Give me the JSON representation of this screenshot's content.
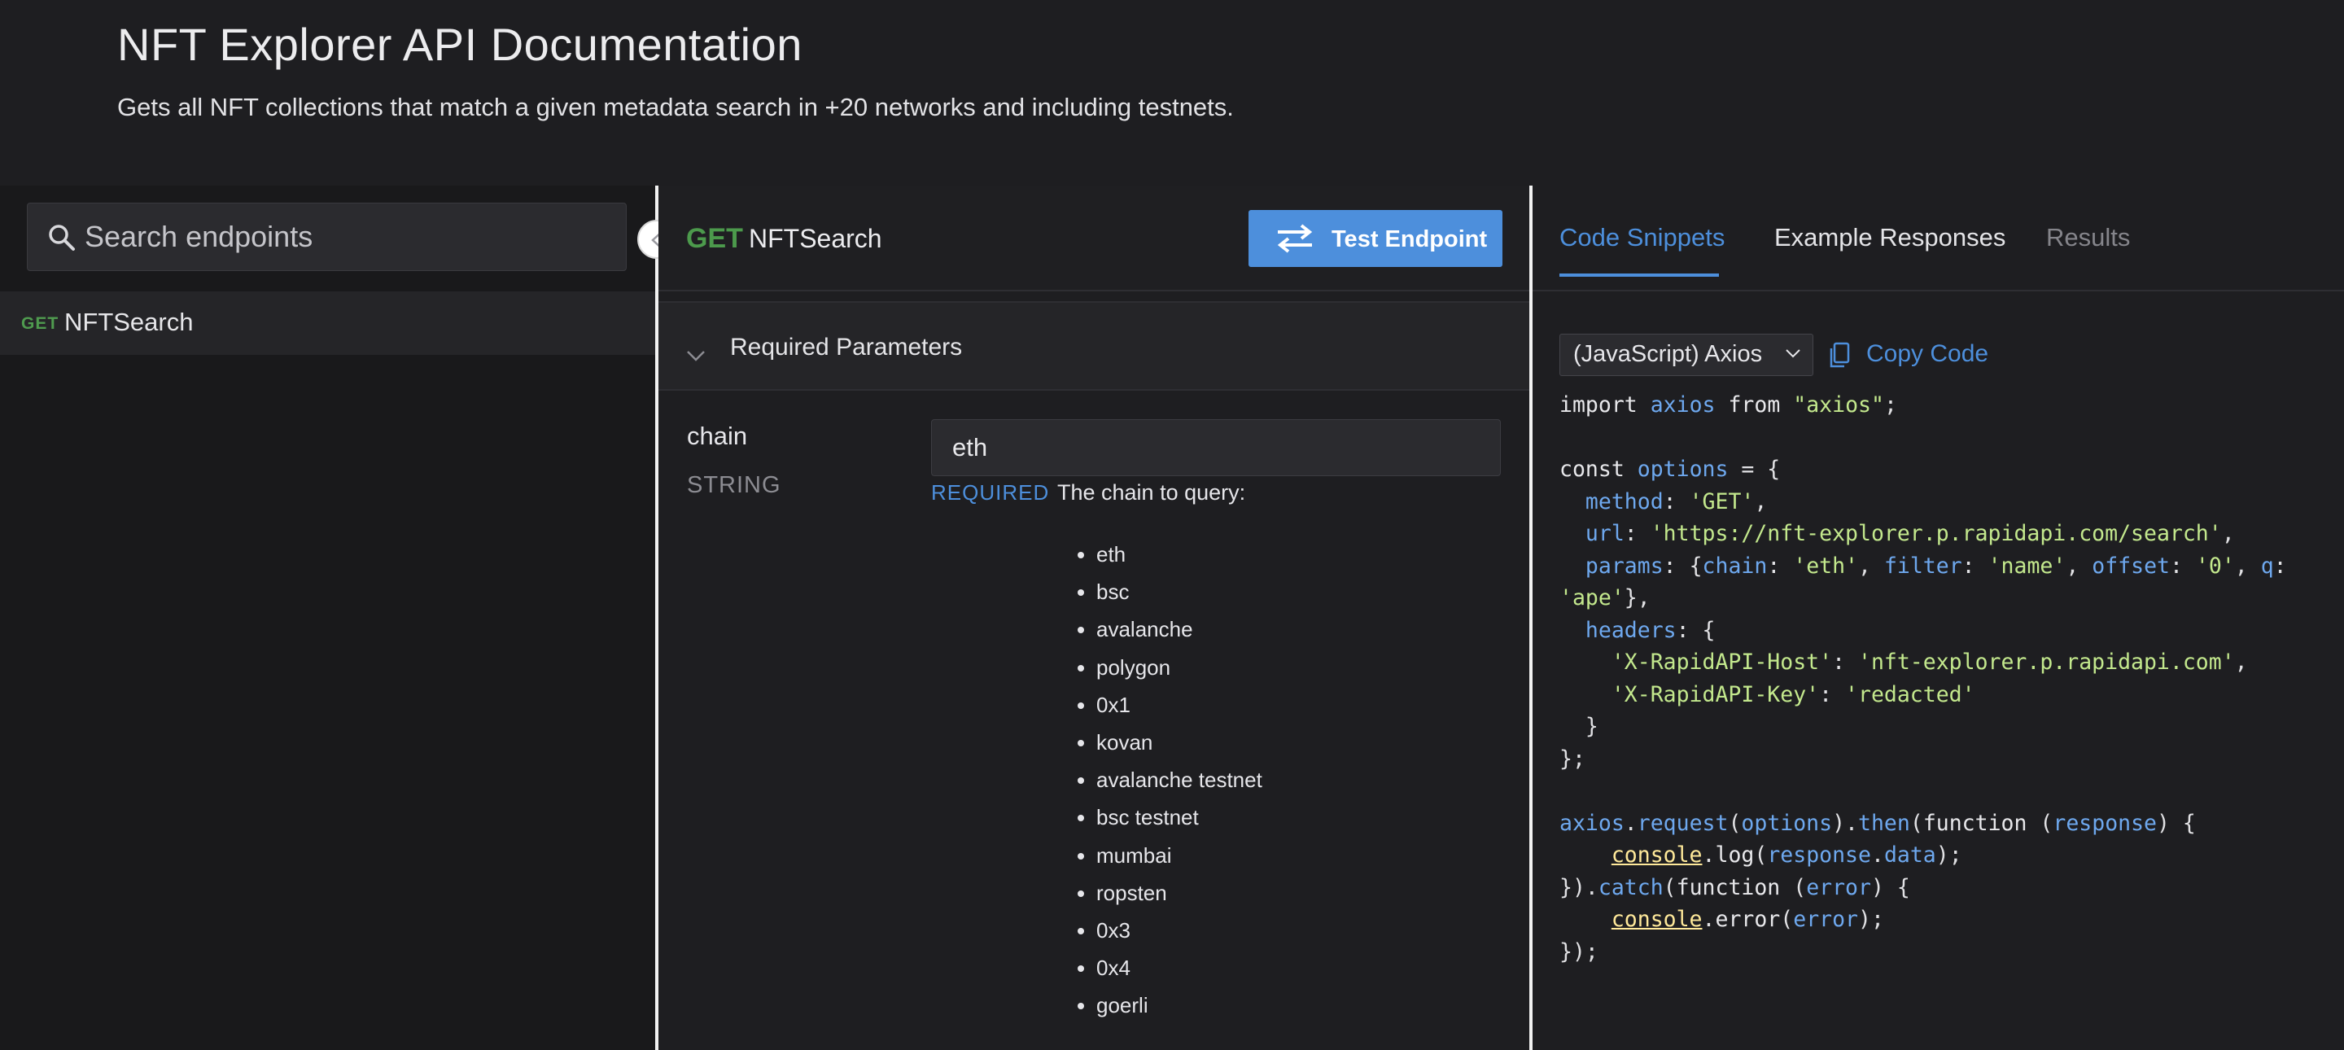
{
  "header": {
    "title": "NFT Explorer API Documentation",
    "description": "Gets all NFT collections that match a given metadata search in +20 networks and including testnets."
  },
  "sidebar": {
    "search_placeholder": "Search endpoints",
    "items": [
      {
        "method": "GET",
        "name": "NFTSearch"
      }
    ]
  },
  "endpoint": {
    "method": "GET",
    "name": "NFTSearch",
    "test_button_label": "Test Endpoint",
    "required_section_label": "Required Parameters",
    "params": [
      {
        "name": "chain",
        "type": "STRING",
        "value": "eth",
        "required_label": "REQUIRED",
        "description": "The chain to query:",
        "options": [
          "eth",
          "bsc",
          "avalanche",
          "polygon",
          "0x1",
          "kovan",
          "avalanche testnet",
          "bsc testnet",
          "mumbai",
          "ropsten",
          "0x3",
          "0x4",
          "goerli"
        ]
      }
    ]
  },
  "code_panel": {
    "tabs": [
      {
        "label": "Code Snippets",
        "active": true
      },
      {
        "label": "Example Responses",
        "active": false
      },
      {
        "label": "Results",
        "active": false,
        "disabled": true
      }
    ],
    "language": "(JavaScript) Axios",
    "copy_label": "Copy Code",
    "code_lines": [
      "import axios from \"axios\";",
      "",
      "const options = {",
      "  method: 'GET',",
      "  url: 'https://nft-explorer.p.rapidapi.com/search',",
      "  params: {chain: 'eth', filter: 'name', offset: '0', q:",
      "'ape'},",
      "  headers: {",
      "    'X-RapidAPI-Host': 'nft-explorer.p.rapidapi.com',",
      "    'X-RapidAPI-Key': 'redacted'",
      "  }",
      "};",
      "",
      "axios.request(options).then(function (response) {",
      "    console.log(response.data);",
      "}).catch(function (error) {",
      "    console.error(error);",
      "});"
    ]
  },
  "colors": {
    "accent": "#4d8fdc",
    "get_method": "#4c9a4c",
    "background": "#1e1e21",
    "code_string": "#c3e88d",
    "code_identifier": "#6ea8ee"
  }
}
